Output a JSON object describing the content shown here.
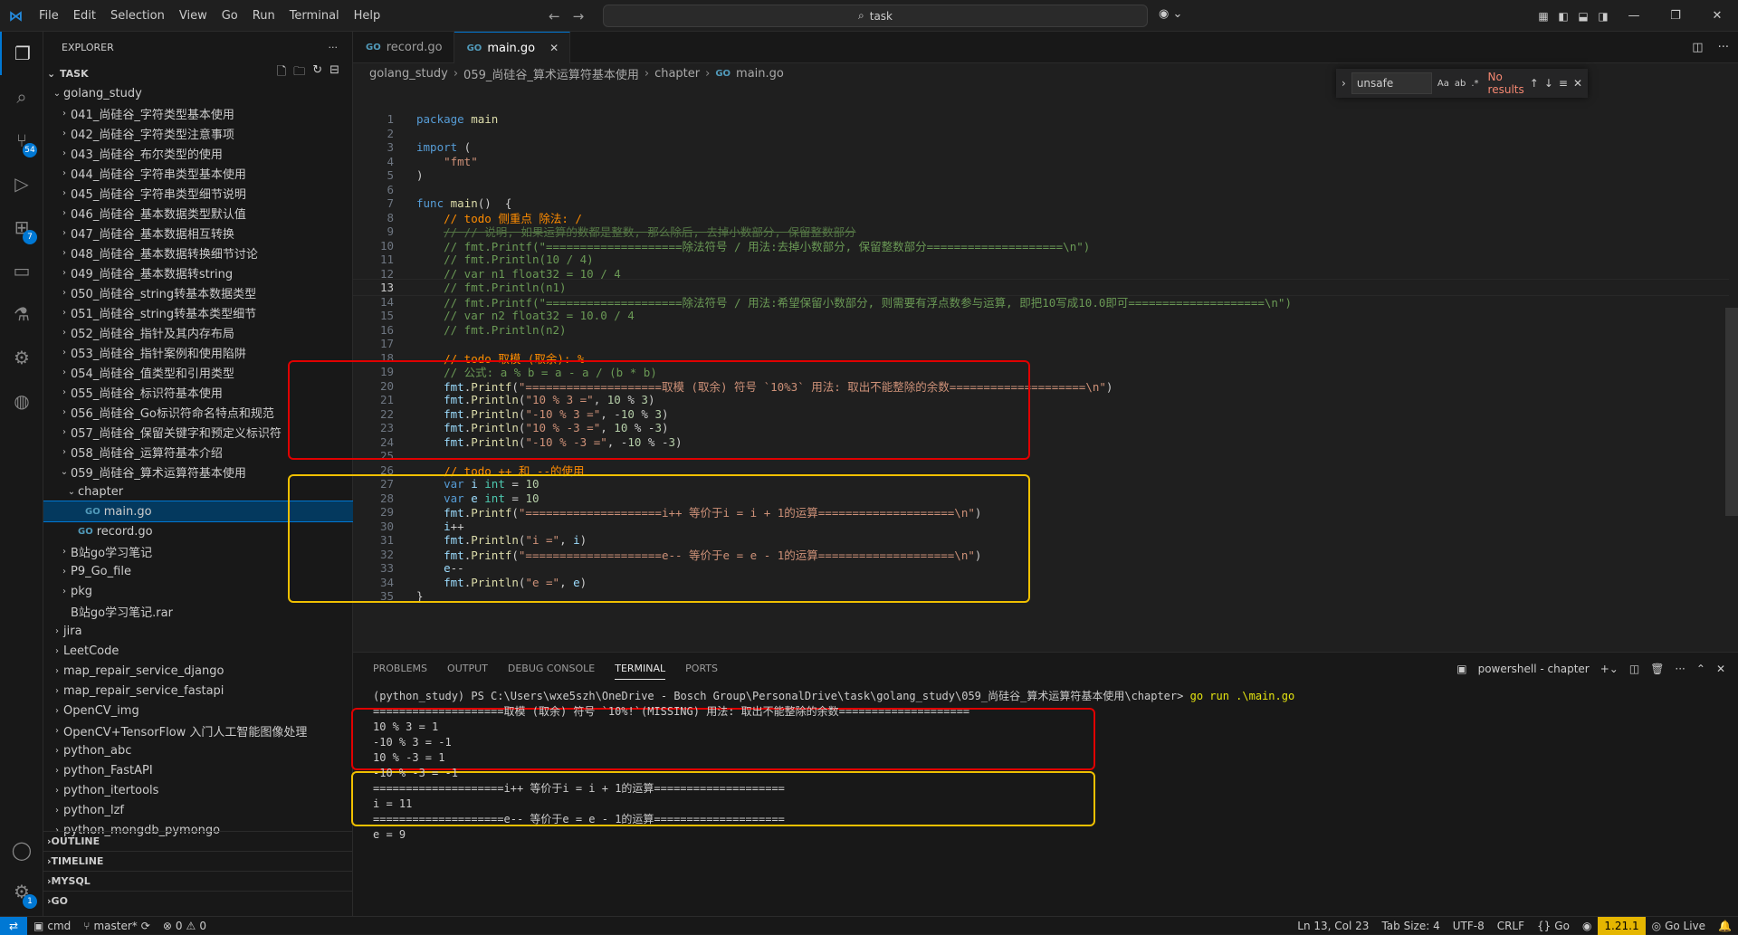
{
  "menu": [
    "File",
    "Edit",
    "Selection",
    "View",
    "Go",
    "Run",
    "Terminal",
    "Help"
  ],
  "search": {
    "label": "task"
  },
  "sidebar": {
    "title": "EXPLORER",
    "root": "TASK",
    "items": [
      {
        "label": "golang_study",
        "depth": 1,
        "type": "open"
      },
      {
        "label": "041_尚硅谷_字符类型基本使用",
        "depth": 2,
        "type": "closed"
      },
      {
        "label": "042_尚硅谷_字符类型注意事项",
        "depth": 2,
        "type": "closed"
      },
      {
        "label": "043_尚硅谷_布尔类型的使用",
        "depth": 2,
        "type": "closed"
      },
      {
        "label": "044_尚硅谷_字符串类型基本使用",
        "depth": 2,
        "type": "closed"
      },
      {
        "label": "045_尚硅谷_字符串类型细节说明",
        "depth": 2,
        "type": "closed"
      },
      {
        "label": "046_尚硅谷_基本数据类型默认值",
        "depth": 2,
        "type": "closed"
      },
      {
        "label": "047_尚硅谷_基本数据相互转换",
        "depth": 2,
        "type": "closed"
      },
      {
        "label": "048_尚硅谷_基本数据转换细节讨论",
        "depth": 2,
        "type": "closed"
      },
      {
        "label": "049_尚硅谷_基本数据转string",
        "depth": 2,
        "type": "closed"
      },
      {
        "label": "050_尚硅谷_string转基本数据类型",
        "depth": 2,
        "type": "closed"
      },
      {
        "label": "051_尚硅谷_string转基本类型细节",
        "depth": 2,
        "type": "closed"
      },
      {
        "label": "052_尚硅谷_指针及其内存布局",
        "depth": 2,
        "type": "closed"
      },
      {
        "label": "053_尚硅谷_指针案例和使用陷阱",
        "depth": 2,
        "type": "closed"
      },
      {
        "label": "054_尚硅谷_值类型和引用类型",
        "depth": 2,
        "type": "closed"
      },
      {
        "label": "055_尚硅谷_标识符基本使用",
        "depth": 2,
        "type": "closed"
      },
      {
        "label": "056_尚硅谷_Go标识符命名特点和规范",
        "depth": 2,
        "type": "closed"
      },
      {
        "label": "057_尚硅谷_保留关键字和预定义标识符",
        "depth": 2,
        "type": "closed"
      },
      {
        "label": "058_尚硅谷_运算符基本介绍",
        "depth": 2,
        "type": "closed"
      },
      {
        "label": "059_尚硅谷_算术运算符基本使用",
        "depth": 2,
        "type": "open"
      },
      {
        "label": "chapter",
        "depth": 3,
        "type": "open"
      },
      {
        "label": "main.go",
        "depth": 4,
        "type": "go",
        "selected": true
      },
      {
        "label": "record.go",
        "depth": 3,
        "type": "go"
      },
      {
        "label": "B站go学习笔记",
        "depth": 2,
        "type": "closed"
      },
      {
        "label": "P9_Go_file",
        "depth": 2,
        "type": "closed"
      },
      {
        "label": "pkg",
        "depth": 2,
        "type": "closed"
      },
      {
        "label": "B站go学习笔记.rar",
        "depth": 2,
        "type": "file"
      },
      {
        "label": "jira",
        "depth": 1,
        "type": "closed"
      },
      {
        "label": "LeetCode",
        "depth": 1,
        "type": "closed"
      },
      {
        "label": "map_repair_service_django",
        "depth": 1,
        "type": "closed"
      },
      {
        "label": "map_repair_service_fastapi",
        "depth": 1,
        "type": "closed"
      },
      {
        "label": "OpenCV_img",
        "depth": 1,
        "type": "closed"
      },
      {
        "label": "OpenCV+TensorFlow 入门人工智能图像处理",
        "depth": 1,
        "type": "closed"
      },
      {
        "label": "python_abc",
        "depth": 1,
        "type": "closed"
      },
      {
        "label": "python_FastAPI",
        "depth": 1,
        "type": "closed"
      },
      {
        "label": "python_itertools",
        "depth": 1,
        "type": "closed"
      },
      {
        "label": "python_lzf",
        "depth": 1,
        "type": "closed"
      },
      {
        "label": "python_mongdb_pymongo",
        "depth": 1,
        "type": "closed"
      }
    ],
    "sections": [
      "OUTLINE",
      "TIMELINE",
      "MYSQL",
      "GO"
    ]
  },
  "activity_badges": {
    "scm": "54",
    "extensions": "7",
    "accounts": "1"
  },
  "tabs": [
    {
      "label": "record.go",
      "active": false
    },
    {
      "label": "main.go",
      "active": true
    }
  ],
  "breadcrumb": [
    "golang_study",
    "059_尚硅谷_算术运算符基本使用",
    "chapter",
    "main.go"
  ],
  "find": {
    "value": "unsafe",
    "result": "No results",
    "opt1": "Aa",
    "opt2": "ab",
    "opt3": ".*"
  },
  "code_lines": [
    "package main",
    "",
    "import (",
    "    \"fmt\"",
    ")",
    "",
    "func main()  {",
    "    // todo 侧重点 除法: /",
    "    // // 说明, 如果运算的数都是整数, 那么除后, 去掉小数部分, 保留整数部分",
    "    // fmt.Printf(\"====================除法符号 / 用法:去掉小数部分, 保留整数部分====================\\n\")",
    "    // fmt.Println(10 / 4)",
    "    // var n1 float32 = 10 / 4",
    "    // fmt.Println(n1)",
    "    // fmt.Printf(\"====================除法符号 / 用法:希望保留小数部分, 则需要有浮点数参与运算, 即把10写成10.0即可====================\\n\")",
    "    // var n2 float32 = 10.0 / 4",
    "    // fmt.Println(n2)",
    "",
    "    // todo 取模 (取余): %",
    "    // 公式: a % b = a - a / (b * b)",
    "    fmt.Printf(\"====================取模 (取余) 符号 `10%3` 用法: 取出不能整除的余数====================\\n\")",
    "    fmt.Println(\"10 % 3 =\", 10 % 3)",
    "    fmt.Println(\"-10 % 3 =\", -10 % 3)",
    "    fmt.Println(\"10 % -3 =\", 10 % -3)",
    "    fmt.Println(\"-10 % -3 =\", -10 % -3)",
    "",
    "    // todo ++ 和 --的使用",
    "    var i int = 10",
    "    var e int = 10",
    "    fmt.Printf(\"====================i++ 等价于i = i + 1的运算====================\\n\")",
    "    i++",
    "    fmt.Println(\"i =\", i)",
    "    fmt.Printf(\"====================e-- 等价于e = e - 1的运算====================\\n\")",
    "    e--",
    "    fmt.Println(\"e =\", e)",
    "}"
  ],
  "line_numbers": [
    "1",
    "2",
    "3",
    "4",
    "5",
    "6",
    "7",
    "8",
    "9",
    "10",
    "11",
    "12",
    "13",
    "14",
    "15",
    "16",
    "17",
    "18",
    "19",
    "20",
    "21",
    "22",
    "23",
    "24",
    "25",
    "26",
    "27",
    "28",
    "29",
    "30",
    "31",
    "32",
    "33",
    "34",
    "35"
  ],
  "panel": {
    "tabs": [
      "PROBLEMS",
      "OUTPUT",
      "DEBUG CONSOLE",
      "TERMINAL",
      "PORTS"
    ],
    "active_tab": "TERMINAL",
    "shell": "powershell - chapter",
    "prompt": "(python_study) PS C:\\Users\\wxe5szh\\OneDrive - Bosch Group\\PersonalDrive\\task\\golang_study\\059_尚硅谷_算术运算符基本使用\\chapter> ",
    "command": "go run .\\main.go",
    "output": [
      "====================取模 (取余) 符号 `10%!`(MISSING) 用法: 取出不能整除的余数====================",
      "10 % 3 = 1",
      "-10 % 3 = -1",
      "10 % -3 = 1",
      "-10 % -3 = -1",
      "====================i++ 等价于i = i + 1的运算====================",
      "i = 11",
      "====================e-- 等价于e = e - 1的运算====================",
      "e = 9"
    ]
  },
  "status": {
    "shell": "cmd",
    "branch": "master*",
    "errors": "0",
    "warnings": "0",
    "position": "Ln 13, Col 23",
    "tab_size": "Tab Size: 4",
    "encoding": "UTF-8",
    "eol": "CRLF",
    "language": "Go",
    "go_version": "1.21.1",
    "golive": "Go Live"
  },
  "colors": {
    "accent": "#0078d4",
    "highlight_red": "#e00000",
    "highlight_orange": "#f0c000"
  }
}
